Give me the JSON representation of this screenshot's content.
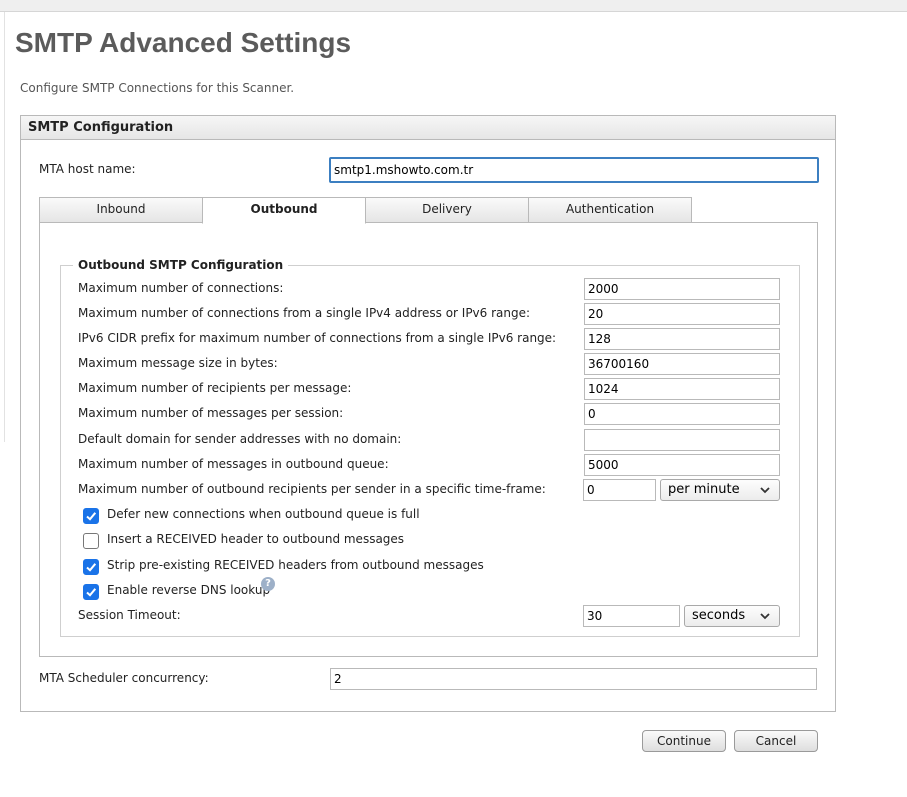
{
  "page": {
    "title": "SMTP Advanced Settings",
    "subtitle": "Configure SMTP Connections for this Scanner."
  },
  "panel": {
    "heading": "SMTP Configuration",
    "mta_host": {
      "label": "MTA host name:",
      "value": "smtp1.mshowto.com.tr"
    },
    "tabs": [
      {
        "label": "Inbound",
        "active": false
      },
      {
        "label": "Outbound",
        "active": true
      },
      {
        "label": "Delivery",
        "active": false
      },
      {
        "label": "Authentication",
        "active": false
      }
    ],
    "scheduler": {
      "label": "MTA Scheduler concurrency:",
      "value": "2"
    }
  },
  "outbound": {
    "legend": "Outbound SMTP Configuration",
    "fields": [
      {
        "label": "Maximum number of connections:",
        "value": "2000"
      },
      {
        "label": "Maximum number of connections from a single IPv4 address or IPv6 range:",
        "value": "20"
      },
      {
        "label": "IPv6 CIDR prefix for maximum number of connections from a single IPv6 range:",
        "value": "128"
      },
      {
        "label": "Maximum message size in bytes:",
        "value": "36700160"
      },
      {
        "label": "Maximum number of recipients per message:",
        "value": "1024"
      },
      {
        "label": "Maximum number of messages per session:",
        "value": "0"
      },
      {
        "label": "Default domain for sender addresses with no domain:",
        "value": ""
      },
      {
        "label": "Maximum number of messages in outbound queue:",
        "value": "5000"
      }
    ],
    "rate": {
      "label": "Maximum number of outbound recipients per sender in a specific time-frame:",
      "value": "0",
      "unit": "per minute"
    },
    "checkboxes": [
      {
        "label": "Defer new connections when outbound queue is full",
        "checked": true
      },
      {
        "label": "Insert a RECEIVED header to outbound messages",
        "checked": false
      },
      {
        "label": "Strip pre-existing RECEIVED headers from outbound messages",
        "checked": true
      },
      {
        "label": "Enable reverse DNS lookup",
        "checked": true
      }
    ],
    "help_glyph": "?",
    "session_timeout": {
      "label": "Session Timeout:",
      "value": "30",
      "unit": "seconds"
    }
  },
  "buttons": {
    "continue": "Continue",
    "cancel": "Cancel"
  },
  "colors": {
    "checkbox": "#1a73e8",
    "title": "#5b5b5b",
    "focus": "#3c7fc1"
  }
}
